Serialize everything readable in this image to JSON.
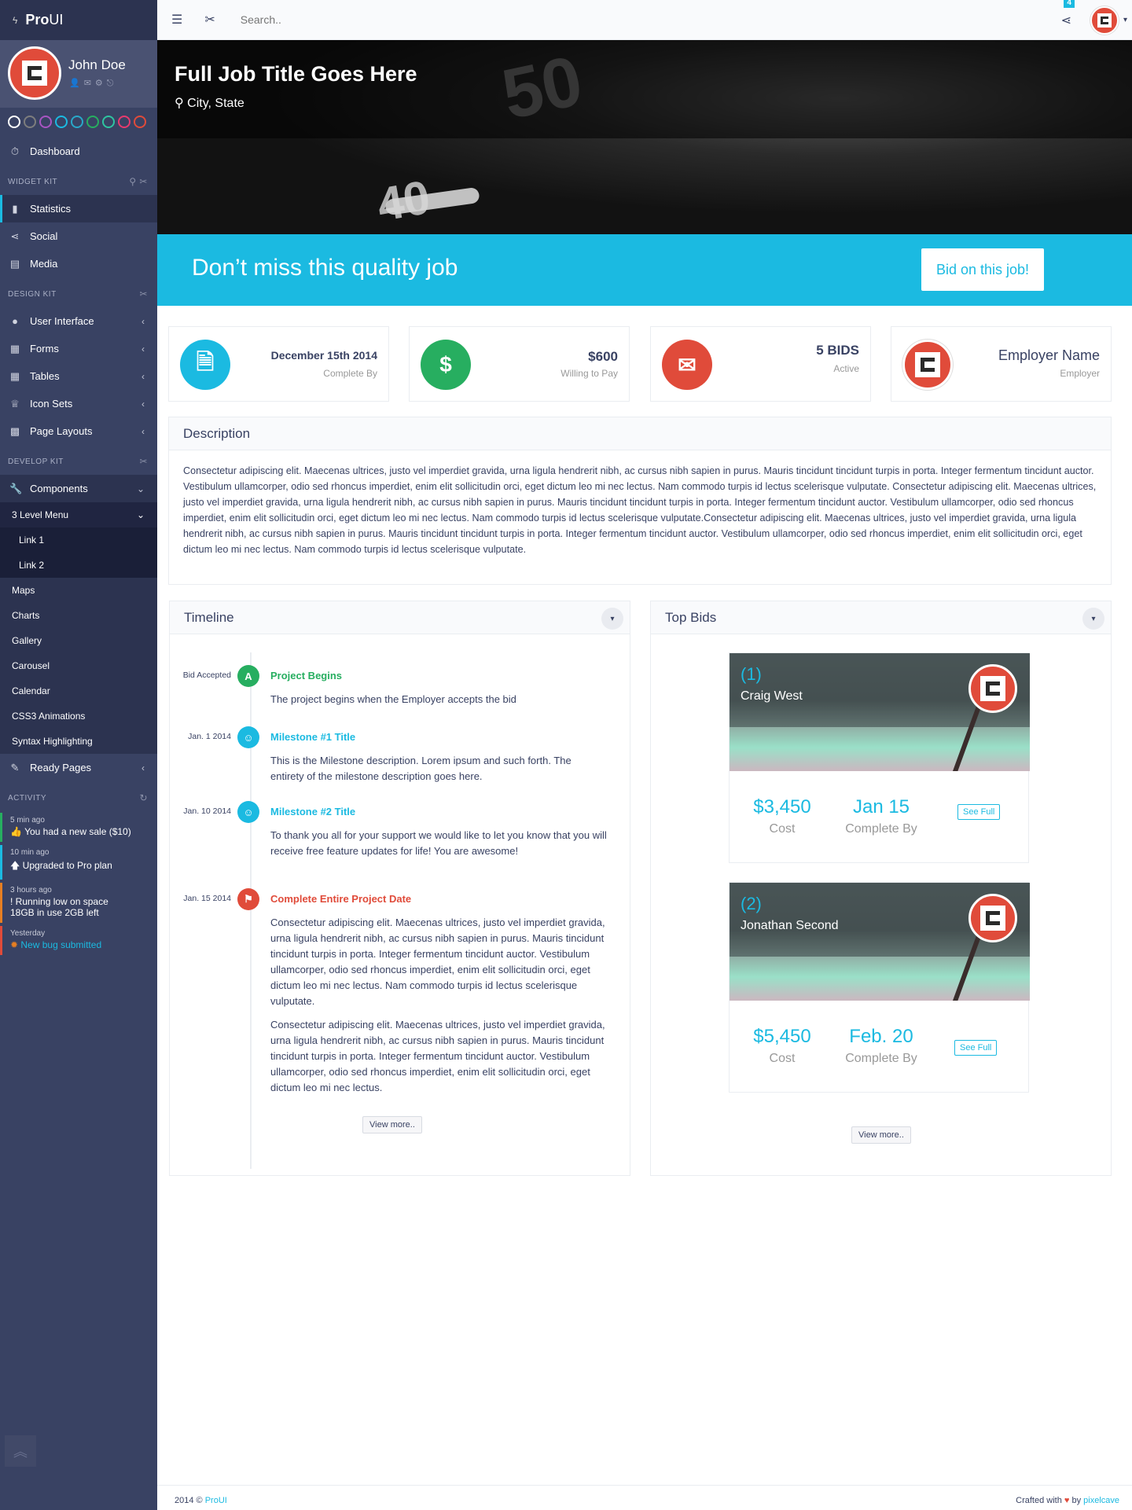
{
  "brand": {
    "bold": "Pro",
    "light": "UI"
  },
  "user": {
    "name": "John Doe"
  },
  "themes": [
    "#ffffff",
    "#7d7d7d",
    "#a855c2",
    "#1bbae1",
    "#29a8c9",
    "#27ae60",
    "#2ec4a0",
    "#e83a6e",
    "#e04b3a"
  ],
  "sidebar": {
    "dashboard": "Dashboard",
    "widget_kit": "WIDGET KIT",
    "widget_items": [
      "Statistics",
      "Social",
      "Media"
    ],
    "design_kit": "DESIGN KIT",
    "design_items": [
      "User Interface",
      "Forms",
      "Tables",
      "Icon Sets",
      "Page Layouts"
    ],
    "develop_kit": "DEVELOP KIT",
    "components": "Components",
    "level3": "3 Level Menu",
    "links": [
      "Link 1",
      "Link 2"
    ],
    "comp_items": [
      "Maps",
      "Charts",
      "Gallery",
      "Carousel",
      "Calendar",
      "CSS3 Animations",
      "Syntax Highlighting"
    ],
    "ready": "Ready Pages",
    "activity": "ACTIVITY"
  },
  "activity": [
    {
      "time": "5 min ago",
      "msg": "You had a new sale ($10)",
      "color": "#27ae60",
      "link": false
    },
    {
      "time": "10 min ago",
      "msg": "Upgraded to Pro plan",
      "color": "#1bbae1",
      "link": false
    },
    {
      "time": "3 hours ago",
      "msg": "Running low on space",
      "msg2": "18GB in use 2GB left",
      "color": "#e67e22",
      "link": false
    },
    {
      "time": "Yesterday",
      "msg": "New bug submitted",
      "color": "#e04b3a",
      "link": true
    }
  ],
  "topbar": {
    "search_placeholder": "Search..",
    "notif_count": "4"
  },
  "hero": {
    "title": "Full Job Title Goes Here",
    "location": "City, State"
  },
  "cta": {
    "text": "Don’t miss this quality job",
    "button": "Bid on this job!"
  },
  "stats": [
    {
      "value": "December 15th 2014",
      "label": "Complete By",
      "icon": "document-icon",
      "color": "#1bbae1"
    },
    {
      "value": "$600",
      "label": "Willing to Pay",
      "icon": "dollar-icon",
      "color": "#27ae60"
    },
    {
      "value": "5 BIDS",
      "label": "Active",
      "icon": "envelope-icon",
      "color": "#e04b3a"
    },
    {
      "value": "Employer Name",
      "label": "Employer",
      "icon": "logo-icon",
      "color": "#e04b3a"
    }
  ],
  "description": {
    "title": "Description",
    "text": "Consectetur adipiscing elit. Maecenas ultrices, justo vel imperdiet gravida, urna ligula hendrerit nibh, ac cursus nibh sapien in purus. Mauris tincidunt tincidunt turpis in porta. Integer fermentum tincidunt auctor. Vestibulum ullamcorper, odio sed rhoncus imperdiet, enim elit sollicitudin orci, eget dictum leo mi nec lectus. Nam commodo turpis id lectus scelerisque vulputate.  Consectetur adipiscing elit. Maecenas ultrices, justo vel imperdiet gravida, urna ligula hendrerit nibh, ac cursus nibh sapien in purus. Mauris tincidunt tincidunt turpis in porta. Integer fermentum tincidunt auctor. Vestibulum ullamcorper, odio sed rhoncus imperdiet, enim elit sollicitudin orci, eget dictum leo mi nec lectus. Nam commodo turpis id lectus scelerisque vulputate.Consectetur adipiscing elit. Maecenas ultrices, justo vel imperdiet gravida, urna ligula hendrerit nibh, ac cursus nibh sapien in purus. Mauris tincidunt tincidunt turpis in porta. Integer fermentum tincidunt auctor. Vestibulum ullamcorper, odio sed rhoncus imperdiet, enim elit sollicitudin orci, eget dictum leo mi nec lectus. Nam commodo turpis id lectus scelerisque vulputate."
  },
  "timeline": {
    "title": "Timeline",
    "items": [
      {
        "date": "Bid Accepted",
        "title": "Project Begins",
        "body": "The project begins when the Employer accepts the bid",
        "color": "#27ae60"
      },
      {
        "date": "Jan. 1 2014",
        "title": "Milestone #1 Title",
        "body": "This is the Milestone description.  Lorem ipsum and such forth. The entirety of the milestone description goes here.",
        "color": "#1bbae1"
      },
      {
        "date": "Jan. 10 2014",
        "title": "Milestone #2 Title",
        "body": "To thank you all for your support we would like to let you know that you will receive free feature updates for life! You are awesome!",
        "color": "#1bbae1"
      },
      {
        "date": "Jan. 15 2014",
        "title": "Complete Entire Project Date",
        "body": "Consectetur adipiscing elit. Maecenas ultrices, justo vel imperdiet gravida, urna ligula hendrerit nibh, ac cursus nibh sapien in purus. Mauris tincidunt tincidunt turpis in porta. Integer fermentum tincidunt auctor. Vestibulum ullamcorper, odio sed rhoncus imperdiet, enim elit sollicitudin orci, eget dictum leo mi nec lectus. Nam commodo turpis id lectus scelerisque vulputate.",
        "body2": "Consectetur adipiscing elit. Maecenas ultrices, justo vel imperdiet gravida, urna ligula hendrerit nibh, ac cursus nibh sapien in purus. Mauris tincidunt tincidunt turpis in porta. Integer fermentum tincidunt auctor. Vestibulum ullamcorper, odio sed rhoncus imperdiet, enim elit sollicitudin orci, eget dictum leo mi nec lectus.",
        "color": "#e04b3a"
      }
    ],
    "more": "View more.."
  },
  "bids": {
    "title": "Top Bids",
    "items": [
      {
        "num": "(1)",
        "name": "Craig West",
        "cost": "$3,450",
        "cost_label": "Cost",
        "date": "Jan 15",
        "date_label": "Complete By",
        "btn": "See Full"
      },
      {
        "num": "(2)",
        "name": "Jonathan Second",
        "cost": "$5,450",
        "cost_label": "Cost",
        "date": "Feb. 20",
        "date_label": "Complete By",
        "btn": "See Full"
      }
    ],
    "more": "View more.."
  },
  "footer": {
    "left_prefix": "2014 © ",
    "left_link": "ProUI",
    "right_prefix": "Crafted with ",
    "right_mid": " by ",
    "right_link": "pixelcave"
  }
}
